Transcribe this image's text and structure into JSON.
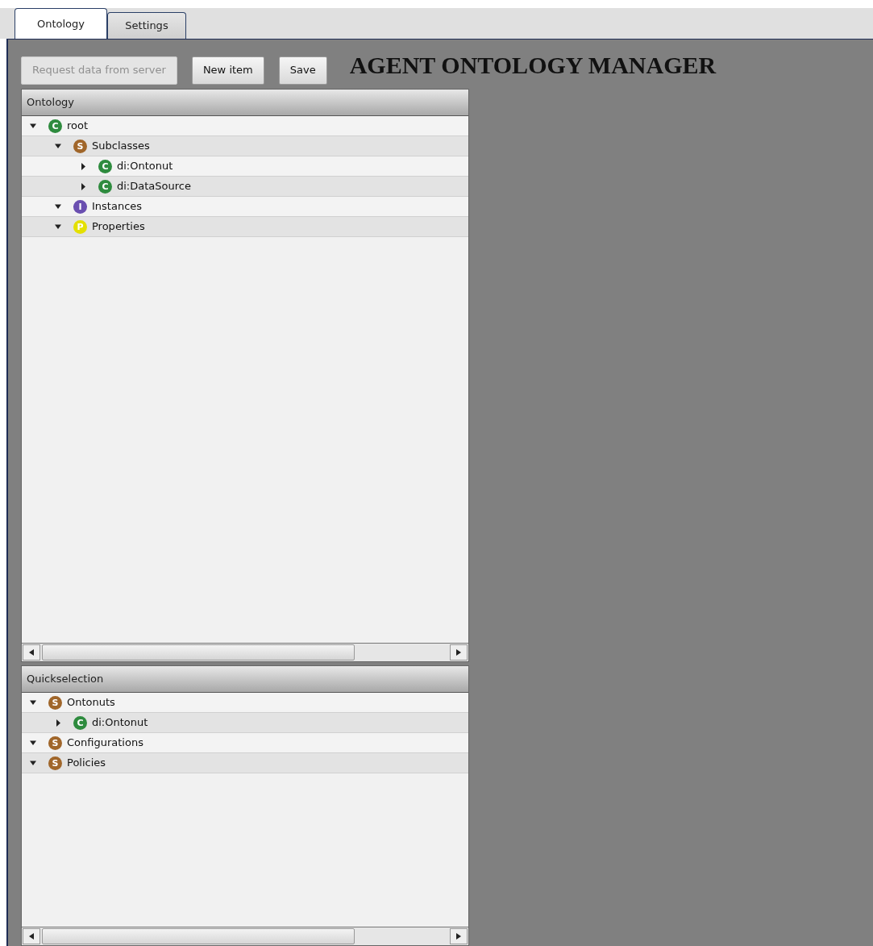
{
  "tabs": [
    {
      "label": "Ontology",
      "selected": true
    },
    {
      "label": "Settings",
      "selected": false
    }
  ],
  "toolbar": {
    "buttons": [
      {
        "label": "Request data from server",
        "disabled": true
      },
      {
        "label": "New item",
        "disabled": false
      },
      {
        "label": "Save",
        "disabled": false
      }
    ],
    "title": "AGENT ONTOLOGY MANAGER"
  },
  "ontology_panel": {
    "header": "Ontology",
    "tree": [
      {
        "label": "root",
        "kind": "class",
        "icon": "C",
        "expanded": true,
        "children": [
          {
            "label": "Subclasses",
            "kind": "set",
            "icon": "S",
            "expanded": true,
            "children": [
              {
                "label": "di:Ontonut",
                "kind": "class",
                "icon": "C",
                "expanded": false
              },
              {
                "label": "di:DataSource",
                "kind": "class",
                "icon": "C",
                "expanded": false
              }
            ]
          },
          {
            "label": "Instances",
            "kind": "instance",
            "icon": "I",
            "expanded": true
          },
          {
            "label": "Properties",
            "kind": "property",
            "icon": "P",
            "expanded": true
          }
        ]
      }
    ]
  },
  "quickselection_panel": {
    "header": "Quickselection",
    "tree": [
      {
        "label": "Ontonuts",
        "kind": "set",
        "icon": "S",
        "expanded": true,
        "children": [
          {
            "label": "di:Ontonut",
            "kind": "class",
            "icon": "C",
            "expanded": false
          }
        ]
      },
      {
        "label": "Configurations",
        "kind": "set",
        "icon": "S",
        "expanded": true
      },
      {
        "label": "Policies",
        "kind": "set",
        "icon": "S",
        "expanded": true
      }
    ]
  }
}
